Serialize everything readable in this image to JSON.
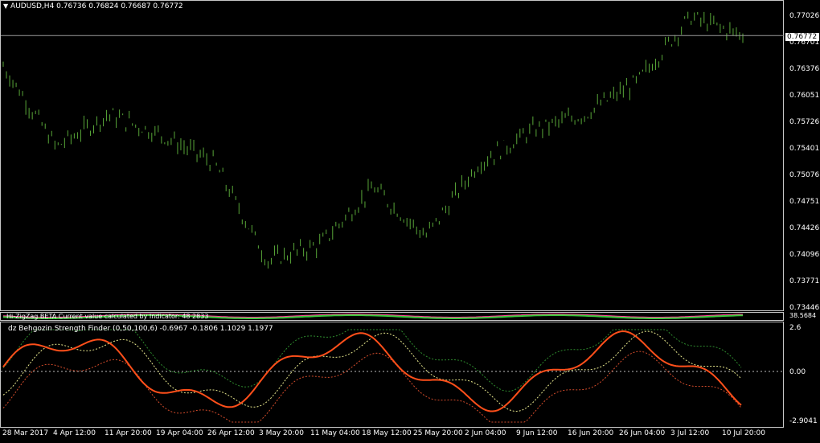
{
  "header": {
    "symbol_timeframe": "AUDUSD,H4",
    "ohlc": "0.76736 0.76824 0.76687 0.76772"
  },
  "price_axis": {
    "ticks": [
      "0.77026",
      "0.76701",
      "0.76376",
      "0.76051",
      "0.75726",
      "0.75401",
      "0.75076",
      "0.74751",
      "0.74426",
      "0.74096",
      "0.73771",
      "0.73446"
    ],
    "current_price": "0.76772"
  },
  "zigzag_indicator": {
    "label": "Hi-ZigZag BETA  Current value calculated by Indicator: 48 2833",
    "scale_label": "38.5684"
  },
  "strength_finder": {
    "label": "dz Behgozin Strength Finder (0,50,100,6) -0.6967 -0.1806 1.1029 1.1977",
    "ticks": [
      "2.6",
      "0.00",
      "-2.9041"
    ]
  },
  "time_axis": {
    "ticks": [
      "28 Mar 2017",
      "4 Apr 12:00",
      "11 Apr 20:00",
      "19 Apr 04:00",
      "26 Apr 12:00",
      "3 May 20:00",
      "11 May 04:00",
      "18 May 12:00",
      "25 May 20:00",
      "2 Jun 04:00",
      "9 Jun 12:00",
      "16 Jun 20:00",
      "26 Jun 04:00",
      "3 Jul 12:00",
      "10 Jul 20:00"
    ]
  },
  "colors": {
    "candles": "#58a638",
    "strength_main": "#ff4f1a",
    "zigzag_pink": "#ff3c9a",
    "zigzag_green": "#3cc83c",
    "band_green": "#2e8b2e",
    "band_yellow": "#e6e68c",
    "band_red": "#d24b2b"
  },
  "chart_data": {
    "type": "line",
    "title": "AUDUSD,H4",
    "ylim": [
      0.7341,
      0.7715
    ],
    "x": [
      "28 Mar 2017",
      "4 Apr 12:00",
      "11 Apr 20:00",
      "19 Apr 04:00",
      "26 Apr 12:00",
      "3 May 20:00",
      "11 May 04:00",
      "18 May 12:00",
      "25 May 20:00",
      "2 Jun 04:00",
      "9 Jun 12:00",
      "16 Jun 20:00",
      "26 Jun 04:00",
      "3 Jul 12:00",
      "10 Jul 20:00"
    ],
    "series": [
      {
        "name": "AUDUSD",
        "values": [
          0.764,
          0.754,
          0.758,
          0.7555,
          0.752,
          0.74,
          0.742,
          0.749,
          0.743,
          0.752,
          0.756,
          0.758,
          0.762,
          0.77,
          0.7677
        ]
      }
    ]
  }
}
